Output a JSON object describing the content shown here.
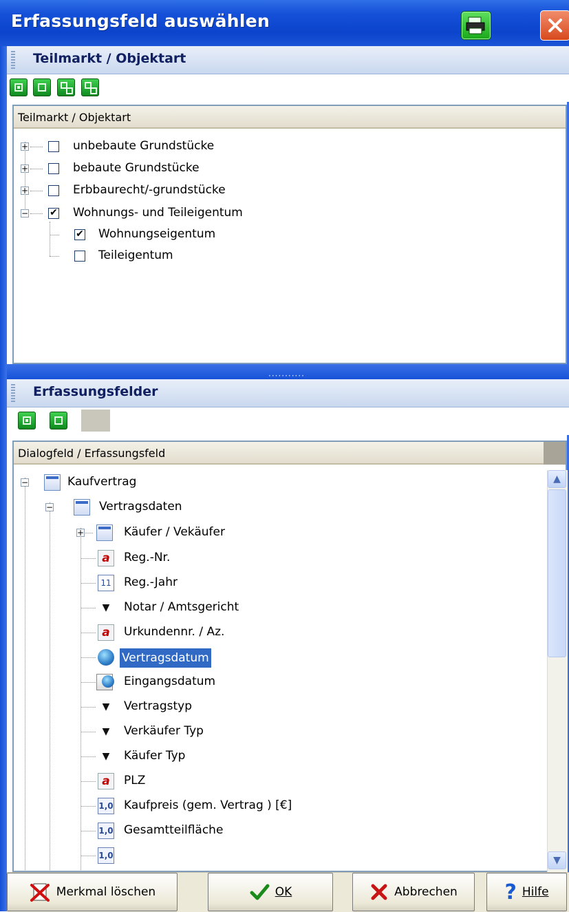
{
  "window": {
    "title": "Erfassungsfeld auswählen"
  },
  "section1": {
    "title": "Teilmarkt / Objektart",
    "toolbar": [
      "expand-all",
      "collapse-all",
      "check-all",
      "uncheck-all"
    ],
    "column_header": "Teilmarkt / Objektart",
    "items": [
      {
        "label": "unbebaute Grundstücke",
        "checked": false,
        "expander": "+"
      },
      {
        "label": "bebaute Grundstücke",
        "checked": false,
        "expander": "+"
      },
      {
        "label": "Erbbaurecht/-grundstücke",
        "checked": false,
        "expander": "+"
      },
      {
        "label": "Wohnungs- und Teileigentum",
        "checked": true,
        "expander": "−"
      },
      {
        "label": "Wohnungseigentum",
        "checked": true
      },
      {
        "label": "Teileigentum",
        "checked": false
      }
    ]
  },
  "section2": {
    "title": "Erfassungsfelder",
    "column_header": "Dialogfeld / Erfassungsfeld",
    "items": [
      {
        "label": "Kaufvertrag",
        "icon": "form-icon"
      },
      {
        "label": "Vertragsdaten",
        "icon": "form-icon"
      },
      {
        "label": "Käufer / Vekäufer",
        "icon": "form-icon"
      },
      {
        "label": "Reg.-Nr.",
        "icon": "text-field-icon"
      },
      {
        "label": "Reg.-Jahr",
        "icon": "number-field-icon"
      },
      {
        "label": "Notar / Amtsgericht",
        "icon": "dropdown-icon"
      },
      {
        "label": "Urkundennr. / Az.",
        "icon": "text-field-icon"
      },
      {
        "label": "Vertragsdatum",
        "icon": "date-icon",
        "selected": true
      },
      {
        "label": "Eingangsdatum",
        "icon": "date-icon"
      },
      {
        "label": "Vertragstyp",
        "icon": "dropdown-icon"
      },
      {
        "label": "Verkäufer Typ",
        "icon": "dropdown-icon"
      },
      {
        "label": "Käufer Typ",
        "icon": "dropdown-icon"
      },
      {
        "label": "PLZ",
        "icon": "text-field-icon"
      },
      {
        "label": "Kaufpreis (gem. Vertrag ) [€]",
        "icon": "decimal-field-icon"
      },
      {
        "label": "Gesamtteilfläche",
        "icon": "decimal-field-icon"
      }
    ]
  },
  "buttons": {
    "delete": "Merkmal löschen",
    "ok": "OK",
    "cancel": "Abbrechen",
    "help": "Hilfe"
  }
}
